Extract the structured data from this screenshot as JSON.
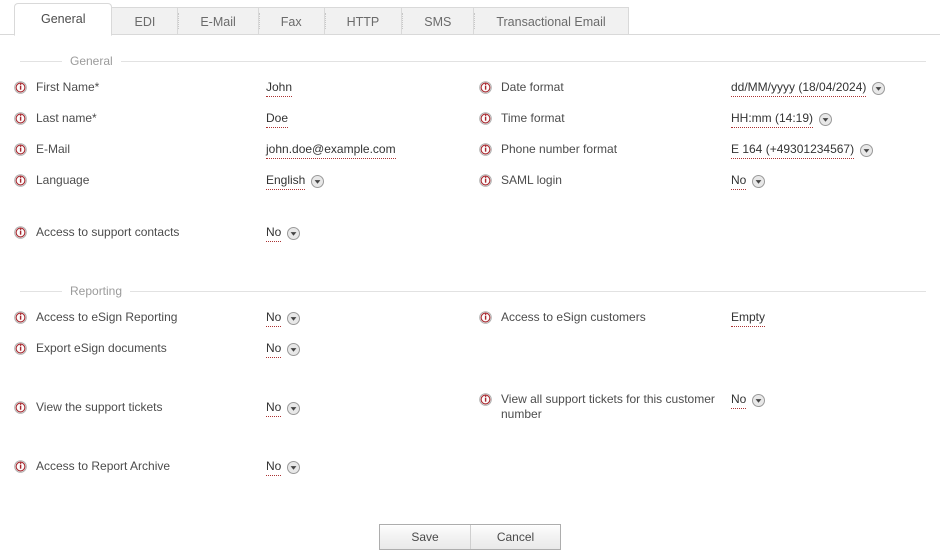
{
  "tabs": [
    {
      "label": "General",
      "active": true
    },
    {
      "label": "EDI",
      "active": false
    },
    {
      "label": "E-Mail",
      "active": false
    },
    {
      "label": "Fax",
      "active": false
    },
    {
      "label": "HTTP",
      "active": false
    },
    {
      "label": "SMS",
      "active": false
    },
    {
      "label": "Transactional Email",
      "active": false
    }
  ],
  "sections": {
    "general": {
      "legend": "General",
      "left": [
        {
          "icon": "info-icon",
          "label": "First Name*",
          "value": "John",
          "dropdown": false
        },
        {
          "icon": "info-icon",
          "label": "Last name*",
          "value": "Doe",
          "dropdown": false
        },
        {
          "icon": "info-icon",
          "label": "E-Mail",
          "value": "john.doe@example.com",
          "dropdown": false
        },
        {
          "icon": "info-icon",
          "label": "Language",
          "value": "English",
          "dropdown": true
        },
        {
          "icon": "info-icon",
          "label": "Access to support contacts",
          "value": "No",
          "dropdown": true
        }
      ],
      "right": [
        {
          "icon": "info-icon",
          "label": "Date format",
          "value": "dd/MM/yyyy (18/04/2024)",
          "dropdown": true
        },
        {
          "icon": "info-icon",
          "label": "Time format",
          "value": "HH:mm (14:19)",
          "dropdown": true
        },
        {
          "icon": "info-icon",
          "label": "Phone number format",
          "value": "E 164 (+49301234567)",
          "dropdown": true
        },
        {
          "icon": "info-icon",
          "label": "SAML login",
          "value": "No",
          "dropdown": true
        }
      ]
    },
    "reporting": {
      "legend": "Reporting",
      "left": [
        {
          "icon": "info-icon",
          "label": "Access to eSign Reporting",
          "value": "No",
          "dropdown": true
        },
        {
          "icon": "info-icon",
          "label": "Export eSign documents",
          "value": "No",
          "dropdown": true
        },
        {
          "icon": "info-icon",
          "label": "View the support tickets",
          "value": "No",
          "dropdown": true
        },
        {
          "icon": "info-icon",
          "label": "Access to Report Archive",
          "value": "No",
          "dropdown": true
        }
      ],
      "right": [
        {
          "icon": "info-icon",
          "label": "Access to eSign customers",
          "value": "Empty",
          "dropdown": false
        },
        {
          "icon": "info-icon",
          "label": "View all support tickets for this customer number",
          "value": "No",
          "dropdown": true
        }
      ]
    }
  },
  "footer": {
    "save_label": "Save",
    "cancel_label": "Cancel"
  },
  "colors": {
    "info_icon": "#a8252c",
    "value_underline": "#aa3333",
    "tab_active_bg": "#ffffff",
    "tab_inactive_bg": "#f1f1f1",
    "text": "#4c4c4c",
    "legend_text": "#9b9b9b",
    "divider": "#e2e2e2"
  }
}
